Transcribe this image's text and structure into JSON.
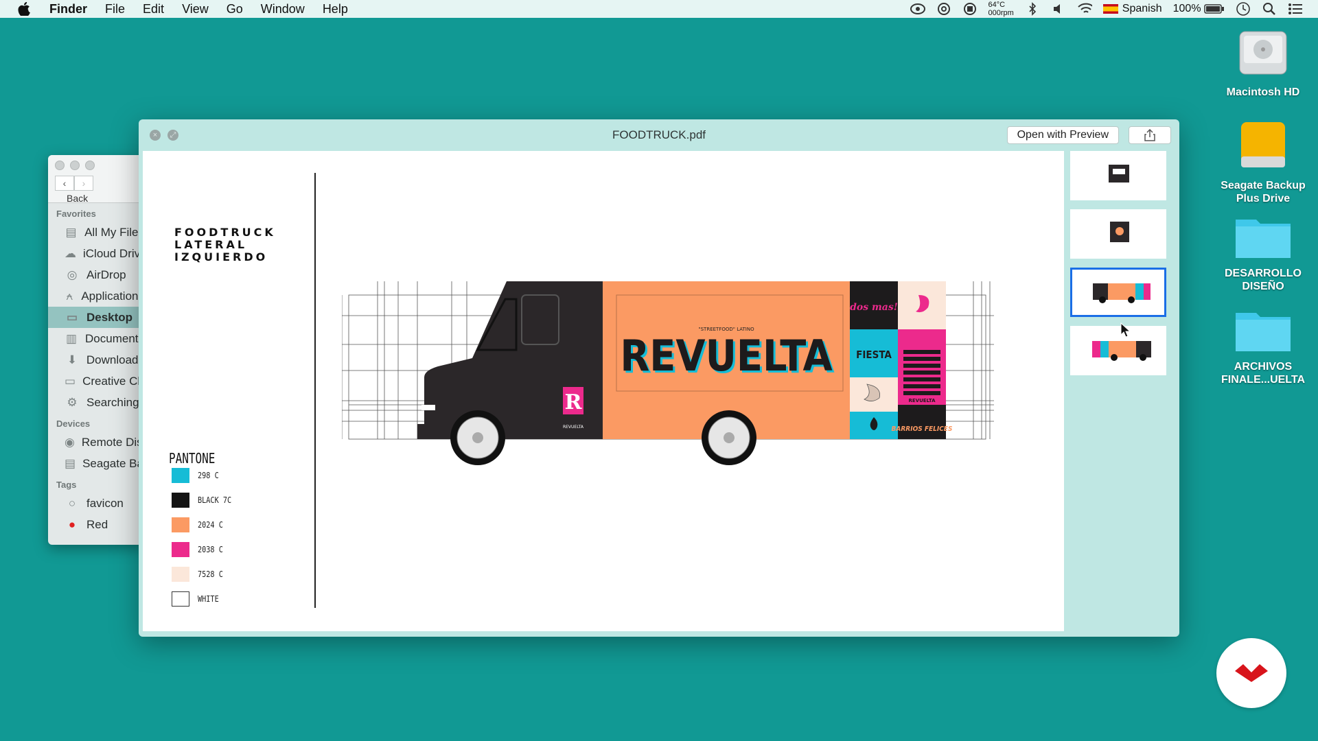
{
  "menubar": {
    "app": "Finder",
    "items": [
      "File",
      "Edit",
      "View",
      "Go",
      "Window",
      "Help"
    ],
    "temp": "64°C",
    "rpm": "000rpm",
    "language": "Spanish",
    "battery": "100%"
  },
  "desktop": {
    "icons": [
      "Macintosh HD",
      "Seagate Backup Plus Drive",
      "DESARROLLO DISEÑO",
      "ARCHIVOS FINALE...UELTA"
    ]
  },
  "finder": {
    "back_label": "Back",
    "favorites_header": "Favorites",
    "favorites": [
      "All My Files",
      "iCloud Drive",
      "AirDrop",
      "Applications",
      "Desktop",
      "Documents",
      "Downloads",
      "Creative Cloud",
      "Searching"
    ],
    "devices_header": "Devices",
    "devices": [
      "Remote Disc",
      "Seagate Backup"
    ],
    "tags_header": "Tags",
    "tags": [
      "favicon",
      "Red"
    ]
  },
  "quicklook": {
    "title": "FOODTRUCK.pdf",
    "open_button": "Open with Preview",
    "selected_thumb": 3,
    "page": {
      "title_lines": [
        "FOODTRUCK",
        "LATERAL",
        "IZQUIERDO"
      ],
      "pantone_header": "PANTONE",
      "swatches": [
        {
          "label": "298 C",
          "color": "#16bcd6"
        },
        {
          "label": "BLACK 7C",
          "color": "#141414"
        },
        {
          "label": "2024 C",
          "color": "#fb9a63"
        },
        {
          "label": "2038 C",
          "color": "#ec2a8c"
        },
        {
          "label": "7528 C",
          "color": "#fbe7da"
        },
        {
          "label": "WHITE",
          "color": "#ffffff"
        }
      ],
      "truck": {
        "brand": "REVUELTA",
        "tagline": "\"STREETFOOD\" LATINO",
        "panel_texts": [
          "dos mas!",
          "FIESTA",
          "BARRIOS FELICES",
          "REVUELTA"
        ]
      }
    }
  },
  "colors": {
    "desktop": "#119994",
    "truck_black": "#2b2729",
    "truck_orange": "#fb9a63",
    "cyan": "#16bcd6",
    "pink": "#ec2a8c"
  }
}
